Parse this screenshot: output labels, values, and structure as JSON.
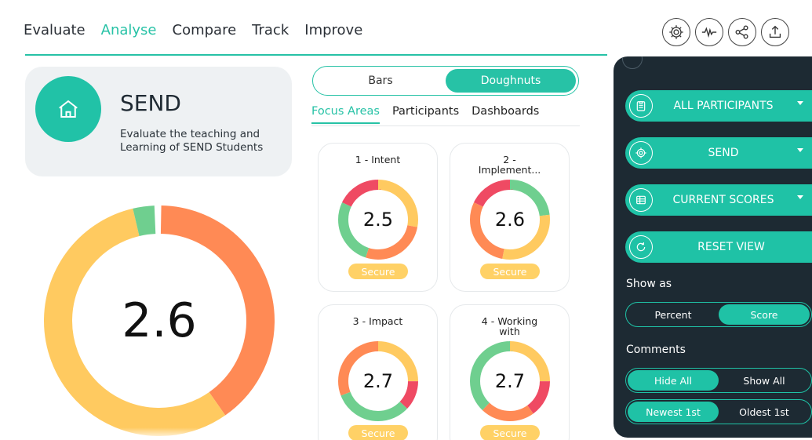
{
  "nav": {
    "items": [
      {
        "label": "Evaluate",
        "active": false
      },
      {
        "label": "Analyse",
        "active": true
      },
      {
        "label": "Compare",
        "active": false
      },
      {
        "label": "Track",
        "active": false
      },
      {
        "label": "Improve",
        "active": false
      }
    ],
    "icons": [
      "gear-icon",
      "pulse-icon",
      "share-icon",
      "upload-icon"
    ]
  },
  "send_card": {
    "title": "SEND",
    "description": "Evaluate the teaching and Learning of SEND Students",
    "icon": "home-icon"
  },
  "overall": {
    "score": "2.6",
    "segments": [
      {
        "color": "#ff8a55",
        "fraction": 0.4
      },
      {
        "color": "#ffca60",
        "fraction": 0.56
      },
      {
        "color": "#6fcf8f",
        "fraction": 0.03
      }
    ]
  },
  "view_toggle": {
    "options": [
      "Bars",
      "Doughnuts"
    ],
    "selected": "Doughnuts"
  },
  "subtabs": {
    "items": [
      "Focus Areas",
      "Participants",
      "Dashboards"
    ],
    "active": "Focus Areas"
  },
  "focus_areas": [
    {
      "title_line1": "1 - Intent",
      "title_line2": "",
      "score": "2.5",
      "status": "Secure",
      "segments": [
        {
          "color": "#ffca60",
          "fraction": 0.28
        },
        {
          "color": "#ff8a55",
          "fraction": 0.27
        },
        {
          "color": "#6fcf8f",
          "fraction": 0.27
        },
        {
          "color": "#ef4a63",
          "fraction": 0.18
        }
      ]
    },
    {
      "title_line1": "2 -",
      "title_line2": "Implement...",
      "score": "2.6",
      "status": "Secure",
      "segments": [
        {
          "color": "#6fcf8f",
          "fraction": 0.23
        },
        {
          "color": "#ffca60",
          "fraction": 0.3
        },
        {
          "color": "#ff8a55",
          "fraction": 0.29
        },
        {
          "color": "#ef4a63",
          "fraction": 0.18
        }
      ]
    },
    {
      "title_line1": "3 - Impact",
      "title_line2": "",
      "score": "2.7",
      "status": "Secure",
      "segments": [
        {
          "color": "#ffca60",
          "fraction": 0.25
        },
        {
          "color": "#ef4a63",
          "fraction": 0.12
        },
        {
          "color": "#6fcf8f",
          "fraction": 0.32
        },
        {
          "color": "#ff8a55",
          "fraction": 0.31
        }
      ]
    },
    {
      "title_line1": "4 - Working",
      "title_line2": "with",
      "score": "2.7",
      "status": "Secure",
      "segments": [
        {
          "color": "#ffca60",
          "fraction": 0.25
        },
        {
          "color": "#ef4a63",
          "fraction": 0.15
        },
        {
          "color": "#ff8a55",
          "fraction": 0.22
        },
        {
          "color": "#6fcf8f",
          "fraction": 0.38
        }
      ]
    }
  ],
  "panel": {
    "buttons": [
      {
        "label": "ALL PARTICIPANTS",
        "icon": "clipboard-icon",
        "dropdown": true
      },
      {
        "label": "SEND",
        "icon": "target-icon",
        "dropdown": true
      },
      {
        "label": "CURRENT SCORES",
        "icon": "table-icon",
        "dropdown": true
      },
      {
        "label": "RESET VIEW",
        "icon": "refresh-icon",
        "dropdown": false
      }
    ],
    "show_as_label": "Show as",
    "show_as": {
      "options": [
        "Percent",
        "Score"
      ],
      "selected": "Score"
    },
    "comments_label": "Comments",
    "comments_visibility": {
      "options": [
        "Hide All",
        "Show All"
      ],
      "selected": "Hide All"
    },
    "comments_order": {
      "options": [
        "Newest 1st",
        "Oldest 1st"
      ],
      "selected": "Newest 1st"
    }
  },
  "colors": {
    "accent": "#27c2a6",
    "panel_bg": "#1d2a33",
    "badge": "#ffd166"
  }
}
